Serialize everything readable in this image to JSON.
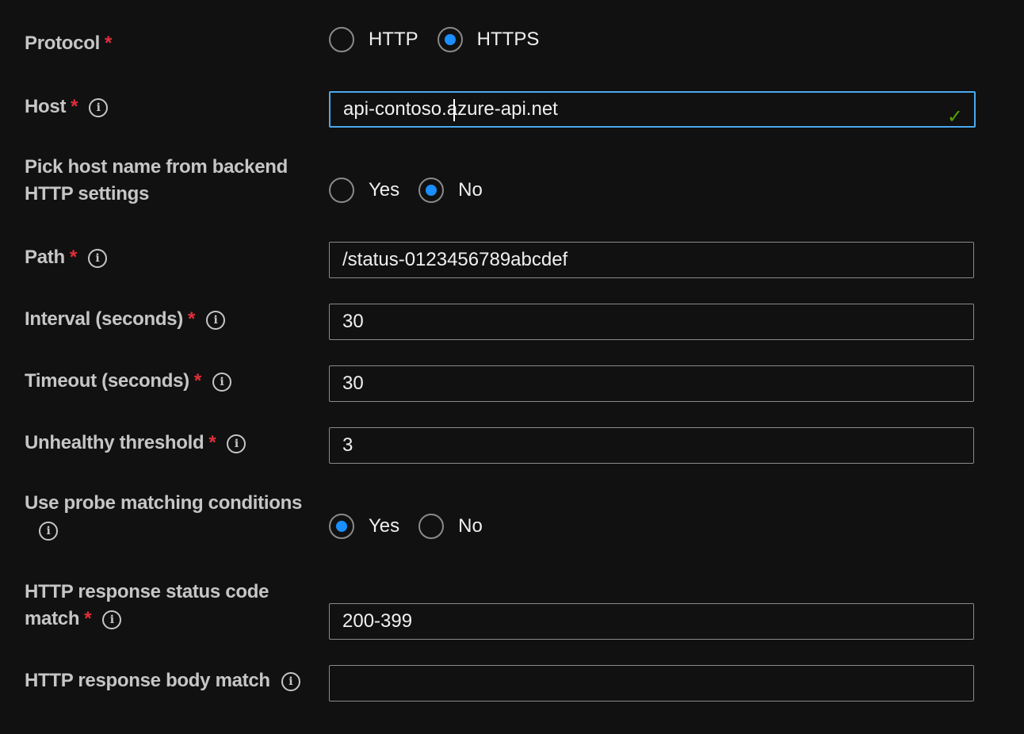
{
  "protocol": {
    "label": "Protocol",
    "required": "*",
    "options": [
      "HTTP",
      "HTTPS"
    ],
    "selected": "HTTPS"
  },
  "host": {
    "label": "Host",
    "required": "*",
    "info": "i",
    "value": "api-contoso.azure-api.net",
    "valid_icon": "✓",
    "valid_color": "#57a300"
  },
  "pick_host": {
    "label_line1": "Pick host name from backend",
    "label_line2": "HTTP settings",
    "options": [
      "Yes",
      "No"
    ],
    "selected": "No"
  },
  "path": {
    "label": "Path",
    "required": "*",
    "info": "i",
    "value": "/status-0123456789abcdef"
  },
  "interval": {
    "label": "Interval (seconds)",
    "required": "*",
    "info": "i",
    "value": "30"
  },
  "timeout": {
    "label": "Timeout (seconds)",
    "required": "*",
    "info": "i",
    "value": "30"
  },
  "unhealthy": {
    "label": "Unhealthy threshold",
    "required": "*",
    "info": "i",
    "value": "3"
  },
  "probe_matching": {
    "label": "Use probe matching conditions",
    "info": "i",
    "options": [
      "Yes",
      "No"
    ],
    "selected": "Yes"
  },
  "status_code": {
    "label_line1": "HTTP response status code",
    "label_line2": "match",
    "required": "*",
    "info": "i",
    "value": "200-399"
  },
  "body_match": {
    "label": "HTTP response body match",
    "info": "i",
    "value": ""
  },
  "colors": {
    "accent": "#1a8fff",
    "focus_border": "#4aa8ef",
    "required": "#e0303a",
    "background": "#111111"
  }
}
